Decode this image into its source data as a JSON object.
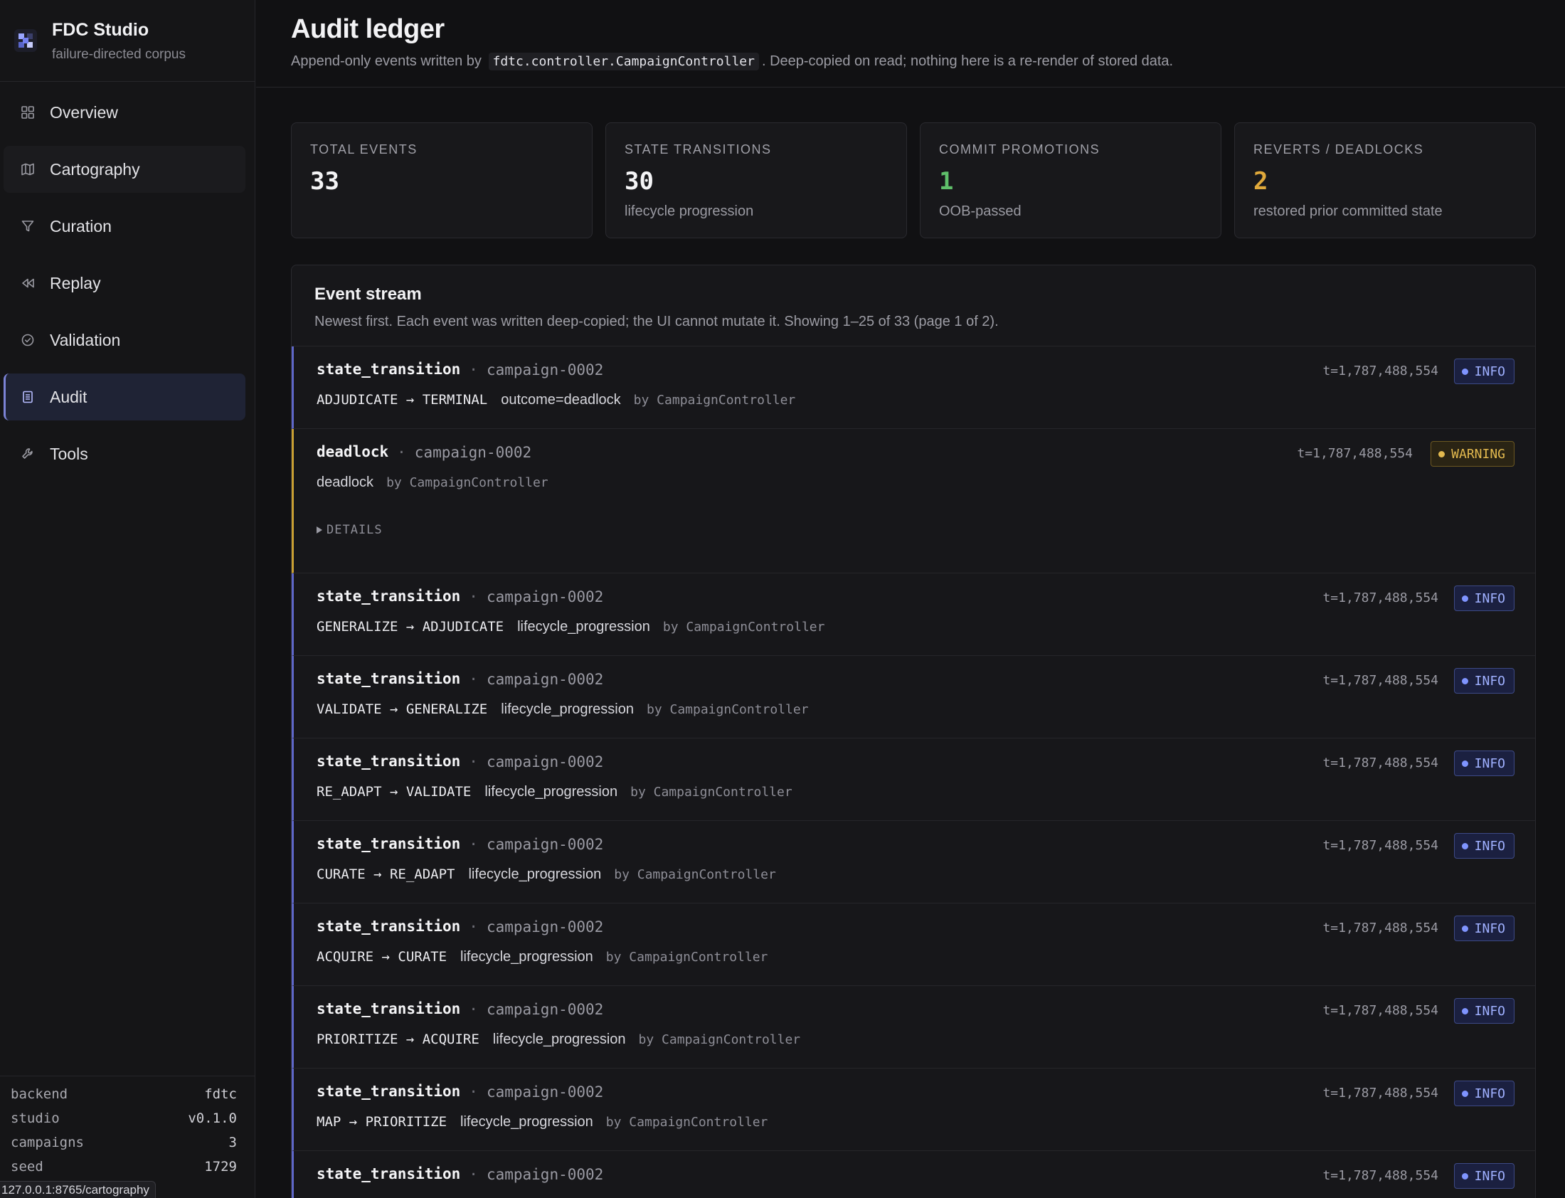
{
  "app": {
    "name": "FDC Studio",
    "subtitle": "failure-directed corpus"
  },
  "nav": [
    {
      "label": "Overview",
      "icon": "grid-icon",
      "state": "default"
    },
    {
      "label": "Cartography",
      "icon": "map-icon",
      "state": "hover"
    },
    {
      "label": "Curation",
      "icon": "filter-icon",
      "state": "default"
    },
    {
      "label": "Replay",
      "icon": "rewind-icon",
      "state": "default"
    },
    {
      "label": "Validation",
      "icon": "check-circle-icon",
      "state": "default"
    },
    {
      "label": "Audit",
      "icon": "ledger-icon",
      "state": "active"
    },
    {
      "label": "Tools",
      "icon": "wrench-icon",
      "state": "default"
    }
  ],
  "footer": [
    {
      "key": "backend",
      "value": "fdtc"
    },
    {
      "key": "studio",
      "value": "v0.1.0"
    },
    {
      "key": "campaigns",
      "value": "3"
    },
    {
      "key": "seed",
      "value": "1729"
    }
  ],
  "status_url": "127.0.0.1:8765/cartography",
  "header": {
    "title": "Audit ledger",
    "desc_before": "Append-only events written by",
    "desc_code": "fdtc.controller.CampaignController",
    "desc_after": ". Deep-copied on read; nothing here is a re-render of stored data."
  },
  "stats": [
    {
      "label": "TOTAL EVENTS",
      "value": "33",
      "sub": "",
      "color": "#f4f4f6"
    },
    {
      "label": "STATE TRANSITIONS",
      "value": "30",
      "sub": "lifecycle progression",
      "color": "#f4f4f6"
    },
    {
      "label": "COMMIT PROMOTIONS",
      "value": "1",
      "sub": "OOB-passed",
      "color": "#5fbf6a"
    },
    {
      "label": "REVERTS / DEADLOCKS",
      "value": "2",
      "sub": "restored prior committed state",
      "color": "#e0a93b"
    }
  ],
  "stream": {
    "title": "Event stream",
    "desc": "Newest first. Each event was written deep-copied; the UI cannot mutate it. Showing 1–25 of 33 (page 1 of 2).",
    "details_label": "DETAILS",
    "events": [
      {
        "type": "state_transition",
        "campaign": "campaign-0002",
        "transition": "ADJUDICATE → TERMINAL",
        "reason": "outcome=deadlock",
        "by": "by CampaignController",
        "ts": "t=1,787,488,554",
        "level": "INFO",
        "details": false
      },
      {
        "type": "deadlock",
        "campaign": "campaign-0002",
        "transition": "",
        "reason": "deadlock",
        "by": "by CampaignController",
        "ts": "t=1,787,488,554",
        "level": "WARNING",
        "details": true
      },
      {
        "type": "state_transition",
        "campaign": "campaign-0002",
        "transition": "GENERALIZE → ADJUDICATE",
        "reason": "lifecycle_progression",
        "by": "by CampaignController",
        "ts": "t=1,787,488,554",
        "level": "INFO",
        "details": false
      },
      {
        "type": "state_transition",
        "campaign": "campaign-0002",
        "transition": "VALIDATE → GENERALIZE",
        "reason": "lifecycle_progression",
        "by": "by CampaignController",
        "ts": "t=1,787,488,554",
        "level": "INFO",
        "details": false
      },
      {
        "type": "state_transition",
        "campaign": "campaign-0002",
        "transition": "RE_ADAPT → VALIDATE",
        "reason": "lifecycle_progression",
        "by": "by CampaignController",
        "ts": "t=1,787,488,554",
        "level": "INFO",
        "details": false
      },
      {
        "type": "state_transition",
        "campaign": "campaign-0002",
        "transition": "CURATE → RE_ADAPT",
        "reason": "lifecycle_progression",
        "by": "by CampaignController",
        "ts": "t=1,787,488,554",
        "level": "INFO",
        "details": false
      },
      {
        "type": "state_transition",
        "campaign": "campaign-0002",
        "transition": "ACQUIRE → CURATE",
        "reason": "lifecycle_progression",
        "by": "by CampaignController",
        "ts": "t=1,787,488,554",
        "level": "INFO",
        "details": false
      },
      {
        "type": "state_transition",
        "campaign": "campaign-0002",
        "transition": "PRIORITIZE → ACQUIRE",
        "reason": "lifecycle_progression",
        "by": "by CampaignController",
        "ts": "t=1,787,488,554",
        "level": "INFO",
        "details": false
      },
      {
        "type": "state_transition",
        "campaign": "campaign-0002",
        "transition": "MAP → PRIORITIZE",
        "reason": "lifecycle_progression",
        "by": "by CampaignController",
        "ts": "t=1,787,488,554",
        "level": "INFO",
        "details": false
      },
      {
        "type": "state_transition",
        "campaign": "campaign-0002",
        "transition": "",
        "reason": "",
        "by": "",
        "ts": "t=1,787,488,554",
        "level": "INFO",
        "details": false
      }
    ]
  }
}
